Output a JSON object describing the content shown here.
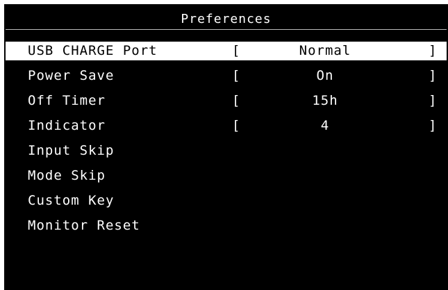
{
  "title": "Preferences",
  "items": [
    {
      "label": "USB CHARGE Port",
      "open": "[",
      "value": "Normal",
      "close": "]"
    },
    {
      "label": "Power Save",
      "open": "[",
      "value": "On",
      "close": "]"
    },
    {
      "label": "Off Timer",
      "open": "[",
      "value": "15h",
      "close": "]"
    },
    {
      "label": "Indicator",
      "open": "[",
      "value": "4",
      "close": "]"
    },
    {
      "label": "Input Skip"
    },
    {
      "label": "Mode Skip"
    },
    {
      "label": "Custom Key"
    },
    {
      "label": "Monitor Reset"
    }
  ],
  "selected_index": 0,
  "colors": {
    "panel_background": "#000000",
    "text": "#ffffff",
    "highlight": "#ffffff",
    "highlight_text": "#000000"
  }
}
